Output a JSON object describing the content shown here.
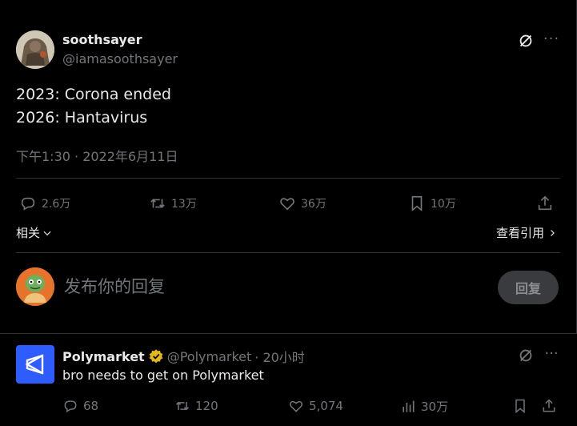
{
  "tweet": {
    "author_name": "soothsayer",
    "author_handle": "@iamasoothsayer",
    "text_lines": [
      "2023: Corona ended",
      "2026: Hantavirus"
    ],
    "meta": "下午1:30 · 2022年6月11日",
    "actions": {
      "reply": "2.6万",
      "retweet": "13万",
      "like": "36万",
      "bookmark": "10万"
    },
    "related_label": "相关",
    "view_quotes_label": "查看引用"
  },
  "reply_box": {
    "placeholder": "发布你的回复",
    "button_label": "回复"
  },
  "reply_tweet": {
    "author_name": "Polymarket",
    "author_handle": "@Polymarket",
    "time": "· 20小时",
    "text": "bro needs to get on Polymarket",
    "actions": {
      "reply": "68",
      "retweet": "120",
      "like": "5,074",
      "views": "30万"
    }
  },
  "colors": {
    "background": "#000000",
    "text_primary": "#e7e9ea",
    "text_secondary": "#71767b",
    "border": "#2f3336",
    "verified_gold": "#e2b719",
    "polymarket_blue": "#2e5cff"
  }
}
